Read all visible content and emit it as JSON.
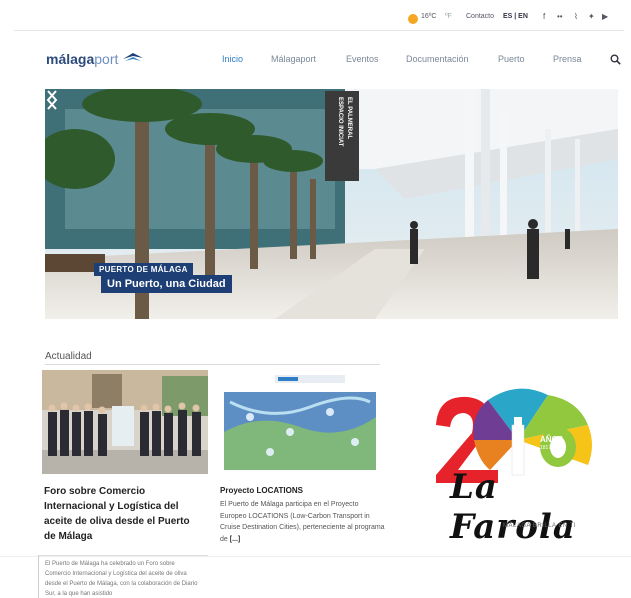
{
  "topbar": {
    "temp": "16ºC",
    "unit_alt": "ºF",
    "contact": "Contacto",
    "language": "ES | EN",
    "social": [
      {
        "icon": "facebook-icon",
        "glyph": "f"
      },
      {
        "icon": "flickr-icon",
        "glyph": "••"
      },
      {
        "icon": "rss-icon",
        "glyph": "⌇"
      },
      {
        "icon": "twitter-icon",
        "glyph": "✦"
      },
      {
        "icon": "youtube-icon",
        "glyph": "▶"
      }
    ]
  },
  "brand": {
    "part1": "málaga",
    "part2": "port"
  },
  "nav": [
    {
      "label": "Inicio",
      "active": true
    },
    {
      "label": "Málagaport",
      "active": false
    },
    {
      "label": "Eventos",
      "active": false
    },
    {
      "label": "Documentación",
      "active": false
    },
    {
      "label": "Puerto",
      "active": false
    },
    {
      "label": "Prensa",
      "active": false
    }
  ],
  "hero": {
    "kicker": "PUERTO DE MÁLAGA",
    "title": "Un Puerto, una Ciudad",
    "banner_line1": "EL PALMERAL",
    "banner_line2": "ESPACIO INICIAT"
  },
  "news": {
    "section_title": "Actualidad",
    "card1": {
      "title": "Foro sobre Comercio Internacional y Logística del aceite de oliva desde el Puerto de Málaga",
      "excerpt": "El Puerto de Málaga ha celebrado un Foro sobre Comercio Internacional y Logística del aceite de oliva desde el Puerto de Málaga, con la colaboración de Diario Sur, a la que han asistido"
    },
    "card2": {
      "title": "Proyecto LOCATIONS",
      "text": "El Puerto de Málaga participa en el Proyecto Europeo LOCATIONS (Low-Carbon Transport in Cruise Destination Cities), perteneciente al programa de ",
      "more": "[...]"
    }
  },
  "ad": {
    "word": "La Farola",
    "subtitle": "MÁLAGA BRILLA EN TI",
    "years": "AÑOS",
    "range": "1817-2017"
  },
  "colors": {
    "accent": "#2f7fc6",
    "brand_navy": "#1d3f76",
    "weather": "#f5a623"
  }
}
